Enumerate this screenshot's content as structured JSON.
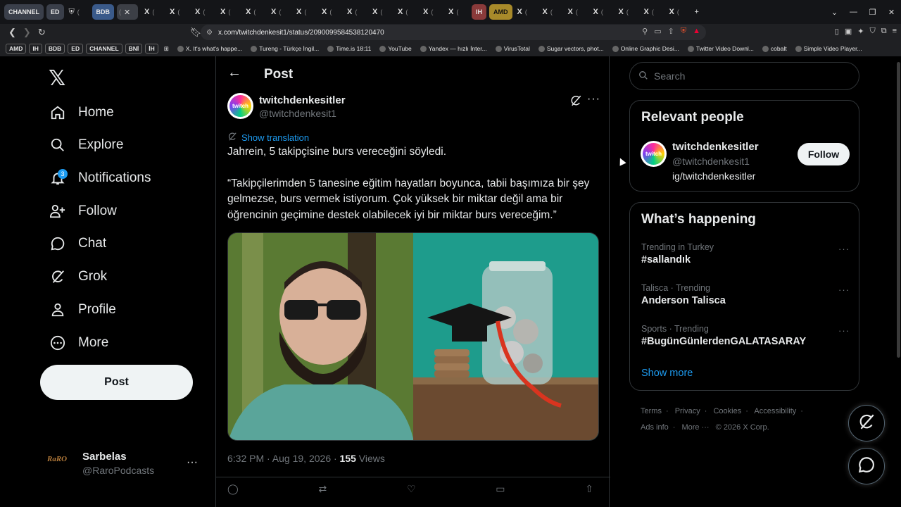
{
  "browser": {
    "tabs_pinned": [
      "CHANNEL",
      "ED"
    ],
    "tab_colors": {
      "CHANNEL": "#3a3f4a",
      "ED": "#3a3f4a",
      "BDB": "#3a5a8a",
      "IH": "#8a3a3a",
      "AMD": "#a88a2a"
    },
    "tab_bdb": "BDB",
    "tab_ih": "IH",
    "tab_amd": "AMD",
    "x_tab_glyph": "X",
    "x_tab_dim": "(",
    "new_tab_glyph": "+",
    "url": "x.com/twitchdenkesit1/status/2090099584538120470",
    "bookmarks": [
      {
        "label": "AMD",
        "boxed": true
      },
      {
        "label": "IH",
        "boxed": true
      },
      {
        "label": "BDB",
        "boxed": true
      },
      {
        "label": "ED",
        "boxed": true
      },
      {
        "label": "CHANNEL",
        "boxed": true
      },
      {
        "label": "BNİ",
        "boxed": true
      },
      {
        "label": "İH",
        "boxed": true
      },
      {
        "label": "X. It's what's happe...",
        "boxed": false
      },
      {
        "label": "Tureng - Türkçe İngil...",
        "boxed": false
      },
      {
        "label": "Time.is 18:11",
        "boxed": false
      },
      {
        "label": "YouTube",
        "boxed": false
      },
      {
        "label": "Yandex — hızlı İnter...",
        "boxed": false
      },
      {
        "label": "VirusTotal",
        "boxed": false
      },
      {
        "label": "Sugar vectors, phot...",
        "boxed": false
      },
      {
        "label": "Online Graphic Desi...",
        "boxed": false
      },
      {
        "label": "Twitter Video Downl...",
        "boxed": false
      },
      {
        "label": "cobalt",
        "boxed": false
      },
      {
        "label": "Simple Video Player...",
        "boxed": false
      }
    ]
  },
  "nav": {
    "items": [
      {
        "label": "Home",
        "icon": "home-icon"
      },
      {
        "label": "Explore",
        "icon": "search-icon"
      },
      {
        "label": "Notifications",
        "icon": "bell-icon",
        "badge": "3"
      },
      {
        "label": "Follow",
        "icon": "add-person-icon"
      },
      {
        "label": "Chat",
        "icon": "chat-icon"
      },
      {
        "label": "Grok",
        "icon": "grok-icon"
      },
      {
        "label": "Profile",
        "icon": "person-icon"
      },
      {
        "label": "More",
        "icon": "more-circle-icon"
      }
    ],
    "post_button": "Post",
    "account": {
      "name": "Sarbelas",
      "handle": "@RaroPodcasts",
      "avatar_text": "RaRO"
    }
  },
  "main": {
    "header_title": "Post",
    "post": {
      "author_name": "twitchdenkesitler",
      "author_handle": "@twitchdenkesit1",
      "avatar_text": "twitch",
      "translation_label": "Show translation",
      "text_p1": "Jahrein, 5 takipçisine burs vereceğini söyledi.",
      "text_p2": "“Takipçilerimden 5 tanesine eğitim hayatları boyunca, tabii başımıza bir şey gelmezse, burs vermek istiyorum. Çok yüksek bir miktar değil ama bir öğrencinin geçimine destek olabilecek iyi bir miktar burs vereceğim.”",
      "time": "6:32 PM · Aug 19, 2026 · ",
      "views_count": "155",
      "views_label": " Views"
    }
  },
  "sidebar": {
    "search_placeholder": "Search",
    "relevant_title": "Relevant people",
    "relevant_person": {
      "name": "twitchdenkesitler",
      "handle": "@twitchdenkesit1",
      "bio": "ig/twitchdenkesitler",
      "follow": "Follow"
    },
    "happening_title": "What’s happening",
    "trends": [
      {
        "context": "Trending in Turkey",
        "title": "#sallandık"
      },
      {
        "context": "Talisca · Trending",
        "title": "Anderson Talisca"
      },
      {
        "context": "Sports · Trending",
        "title": "#BugünGünlerdenGALATASARAY"
      }
    ],
    "show_more": "Show more",
    "footer": [
      "Terms",
      "·",
      "Privacy",
      "·",
      "Cookies",
      "·",
      "Accessibility",
      "·",
      "Ads info",
      "·",
      "More ···",
      "© 2026 X Corp."
    ]
  },
  "colors": {
    "accent": "#1d9bf0",
    "bg": "#000000",
    "text": "#e7e9ea",
    "muted": "#71767b",
    "border": "#2f3336"
  }
}
